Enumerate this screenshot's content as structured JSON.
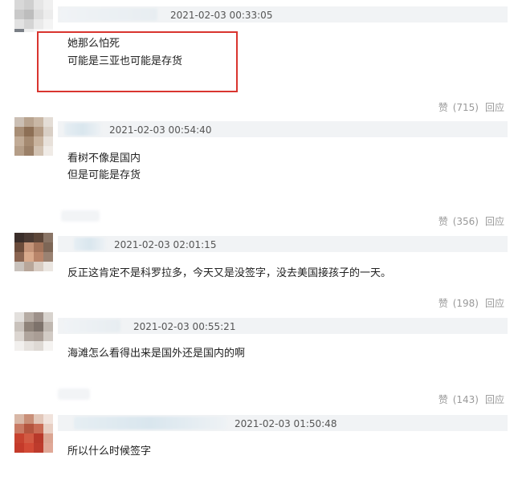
{
  "comments": [
    {
      "timestamp": "2021-02-03 00:33:05",
      "lines": [
        "她那么怕死",
        "可能是三亚也可能是存货"
      ],
      "like_label": "赞",
      "like_count": "(715)",
      "reply_label": "回应"
    },
    {
      "timestamp": "2021-02-03 00:54:40",
      "lines": [
        "看树不像是国内",
        "但是可能是存货"
      ],
      "like_label": "赞",
      "like_count": "(356)",
      "reply_label": "回应"
    },
    {
      "timestamp": "2021-02-03 02:01:15",
      "lines": [
        "反正这肯定不是科罗拉多，今天又是没签字，没去美国接孩子的一天。"
      ],
      "like_label": "赞",
      "like_count": "(198)",
      "reply_label": "回应"
    },
    {
      "timestamp": "2021-02-03 00:55:21",
      "lines": [
        "海滩怎么看得出来是国外还是国内的啊"
      ],
      "like_label": "赞",
      "like_count": "(143)",
      "reply_label": "回应"
    },
    {
      "timestamp": "2021-02-03 01:50:48",
      "lines": [
        "所以什么时候签字"
      ]
    }
  ],
  "colors": {
    "highlight_box": "#d9352f",
    "action_text": "#999999",
    "header_strip": "#f1f3f5"
  },
  "icons": {
    "avatar": "user-avatar-blurred"
  }
}
